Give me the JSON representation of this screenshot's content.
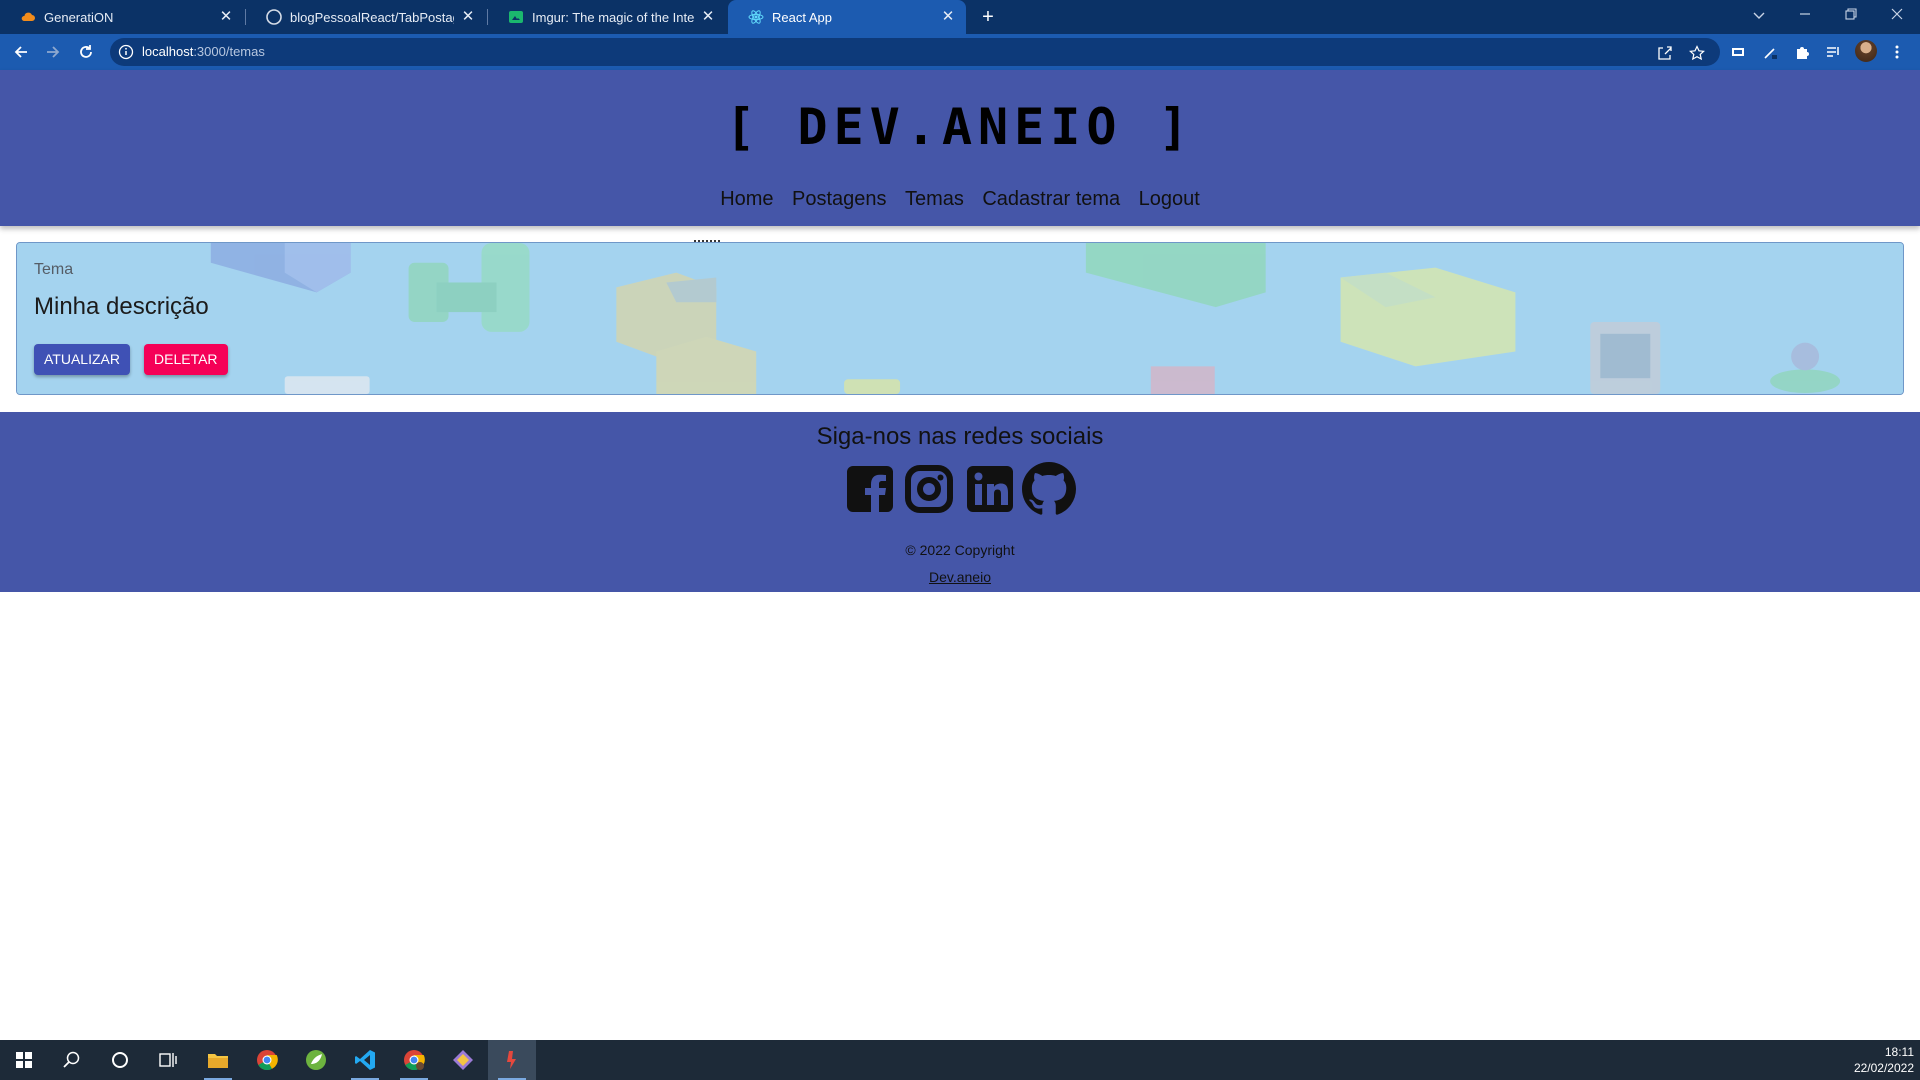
{
  "browser": {
    "tabs": [
      {
        "title": "GeneratiON",
        "close": "✕"
      },
      {
        "title": "blogPessoalReact/TabPostagem.t",
        "close": "✕"
      },
      {
        "title": "Imgur: The magic of the Internet",
        "close": "✕"
      },
      {
        "title": "React App",
        "close": "✕"
      }
    ],
    "new_tab": "+",
    "url_host": "localhost",
    "url_path": ":3000/temas"
  },
  "header": {
    "logo": "[ DEV.ANEIO ]",
    "nav": [
      "Home",
      "Postagens",
      "Temas",
      "Cadastrar tema",
      "Logout"
    ]
  },
  "card": {
    "label": "Tema",
    "description": "Minha descrição",
    "update_label": "Atualizar",
    "delete_label": "Deletar"
  },
  "footer": {
    "title": "Siga-nos nas redes sociais",
    "social_icons": [
      "facebook-icon",
      "instagram-icon",
      "linkedin-icon",
      "github-icon"
    ],
    "copyright": "© 2022 Copyright",
    "brand_link": "Dev.aneio"
  },
  "taskbar": {
    "time": "18:11",
    "date": "22/02/2022"
  },
  "colors": {
    "header_bg": "#4556a8",
    "update_button": "#3f51b5",
    "delete_button": "#f50057",
    "browser_frame": "#1c5bb0"
  }
}
